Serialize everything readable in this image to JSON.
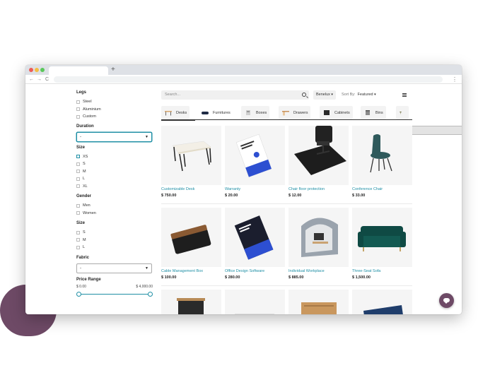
{
  "browser": {
    "new_tab": "+",
    "nav_back": "←",
    "nav_forward": "→",
    "nav_reload": "C",
    "menu": "⋮"
  },
  "filters": {
    "legs": {
      "title": "Legs",
      "options": [
        "Steel",
        "Aluminium",
        "Custom"
      ]
    },
    "duration": {
      "title": "Duration",
      "value": "-"
    },
    "size1": {
      "title": "Size",
      "options": [
        "XS",
        "S",
        "M",
        "L",
        "XL"
      ]
    },
    "gender": {
      "title": "Gender",
      "options": [
        "Men",
        "Women"
      ]
    },
    "size2": {
      "title": "Size",
      "options": [
        "S",
        "M",
        "L"
      ]
    },
    "fabric": {
      "title": "Fabric",
      "value": "-"
    },
    "price": {
      "title": "Price Range",
      "min": "$ 0.00",
      "max": "$ 4,000.00",
      "range_low_fraction": 0.0,
      "range_high_fraction": 1.0
    }
  },
  "toolbar": {
    "search_placeholder": "Search...",
    "pricelist": "Benelux",
    "sort_label": "Sort By:",
    "sort_value": "Featured"
  },
  "categories": [
    "Desks",
    "Furnitures",
    "Boxes",
    "Drawers",
    "Cabinets",
    "Bins"
  ],
  "products": [
    {
      "name": "Customizable Desk",
      "price": "$ 750.00",
      "icon": "desk-image"
    },
    {
      "name": "Warranty",
      "price": "$ 20.00",
      "icon": "warranty-box-image"
    },
    {
      "name": "Chair floor protection",
      "price": "$ 12.00",
      "icon": "floor-mat-image"
    },
    {
      "name": "Conference Chair",
      "price": "$ 33.00",
      "icon": "conference-chair-image"
    },
    {
      "name": "Cable Management Box",
      "price": "$ 100.00",
      "icon": "cable-box-image"
    },
    {
      "name": "Office Design Software",
      "price": "$ 280.00",
      "icon": "software-box-image"
    },
    {
      "name": "Individual Workplace",
      "price": "$ 885.00",
      "icon": "workplace-pod-image"
    },
    {
      "name": "Three-Seat Sofa",
      "price": "$ 1,500.00",
      "icon": "sofa-image"
    }
  ],
  "colors": {
    "accent": "#1f8fa5",
    "brand": "#6e4a66",
    "price": "#222222"
  }
}
